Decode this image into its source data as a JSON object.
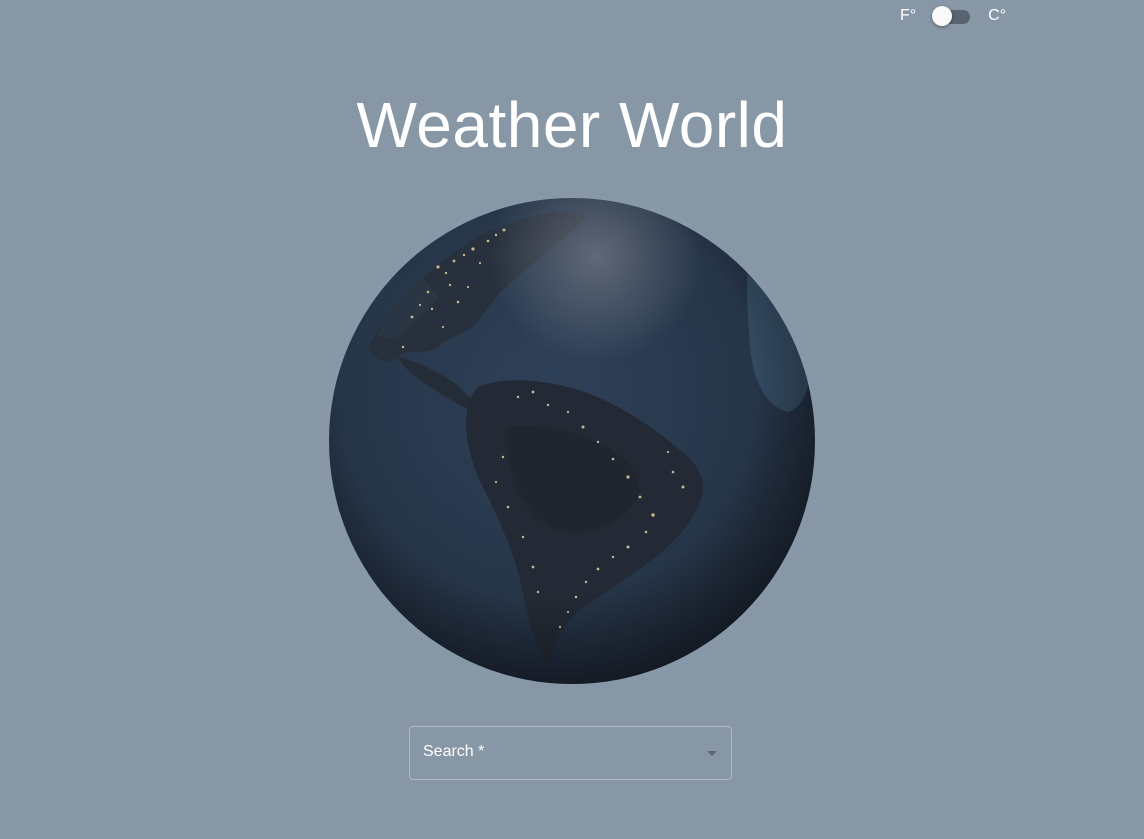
{
  "unit_toggle": {
    "left_label": "F°",
    "right_label": "C°",
    "state": "F"
  },
  "header": {
    "title": "Weather World"
  },
  "globe": {
    "icon": "earth-globe-icon",
    "view": "Americas at night"
  },
  "search": {
    "label": "Search *",
    "value": "",
    "placeholder": ""
  },
  "colors": {
    "background": "#8897a6",
    "text": "#ffffff",
    "globe_ocean": "#2a3a50",
    "globe_land": "#232a35",
    "city_lights": "#f2d9a8"
  }
}
